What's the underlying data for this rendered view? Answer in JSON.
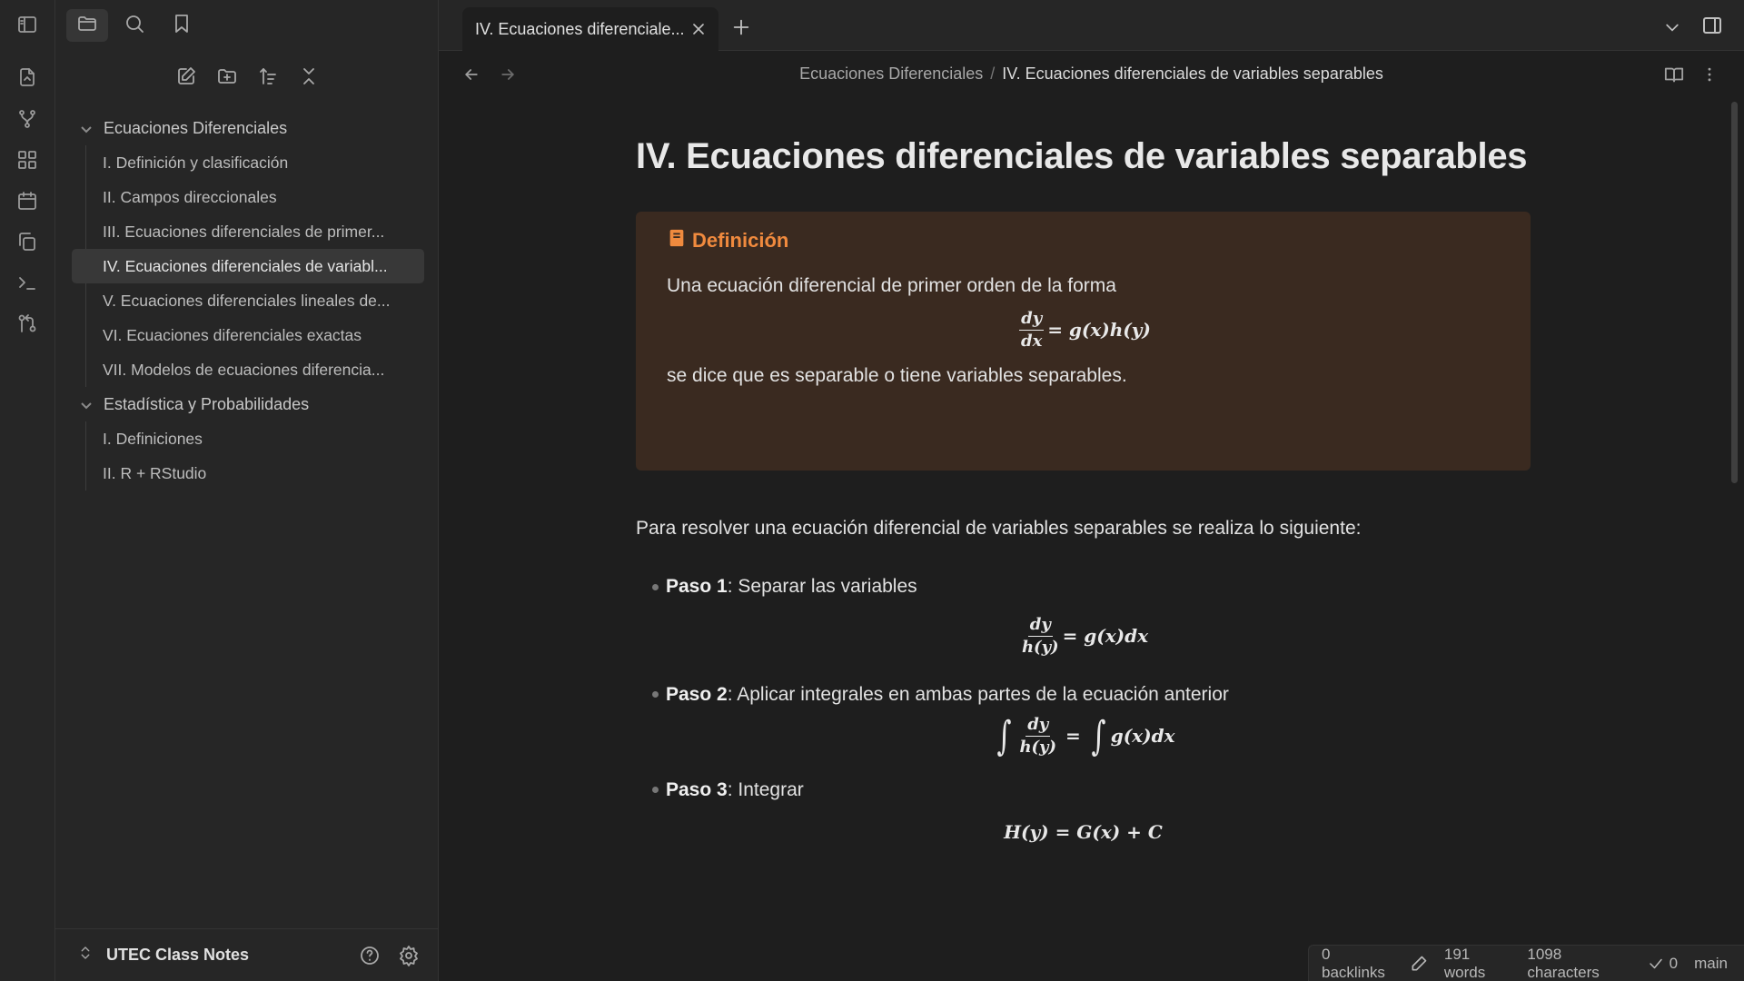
{
  "sidebar_tabs": [
    "folder-icon",
    "search-icon",
    "bookmark-icon"
  ],
  "ribbon_icons": [
    "open-quick-switcher-icon",
    "graph-view-icon",
    "canvas-icon",
    "daily-note-icon",
    "templates-icon",
    "command-palette-icon",
    "git-icon"
  ],
  "tree": {
    "folders": [
      {
        "name": "Ecuaciones Diferenciales",
        "files": [
          "I. Definición y clasificación",
          "II. Campos direccionales",
          "III. Ecuaciones diferenciales de primer...",
          "IV. Ecuaciones diferenciales de variabl...",
          "V. Ecuaciones diferenciales lineales de...",
          "VI. Ecuaciones diferenciales exactas",
          "VII. Modelos de ecuaciones diferencia..."
        ]
      },
      {
        "name": "Estadística y Probabilidades",
        "files": [
          "I. Definiciones",
          "II. R + RStudio"
        ]
      }
    ]
  },
  "vault": {
    "name": "UTEC Class Notes"
  },
  "tab": {
    "title": "IV. Ecuaciones diferenciale..."
  },
  "breadcrumb": {
    "parent": "Ecuaciones Diferenciales",
    "separator": "/",
    "current": "IV. Ecuaciones diferenciales de variables separables"
  },
  "note": {
    "title": "IV. Ecuaciones diferenciales de variables separables",
    "callout": {
      "title": "Definición",
      "intro": "Una ecuación diferencial de primer orden de la forma",
      "eq_num": "dy",
      "eq_den": "dx",
      "eq_rhs": "= g(x)h(y)",
      "outro": "se dice que es separable o tiene variables separables."
    },
    "paragraph": "Para resolver una ecuación diferencial de variables separables se realiza lo siguiente:",
    "steps": [
      {
        "label": "Paso 1",
        "text": ": Separar las variables",
        "eq_num": "dy",
        "eq_den": "h(y)",
        "eq_rhs": "= g(x)dx"
      },
      {
        "label": "Paso 2",
        "text": ": Aplicar integrales en ambas partes de la ecuación anterior",
        "eq_int": "∫",
        "eq_num": "dy",
        "eq_den": "h(y)",
        "eq_eq": "=",
        "eq_rhs": "g(x)dx"
      },
      {
        "label": "Paso 3",
        "text": ": Integrar",
        "eq": "H(y) = G(x) + C"
      }
    ]
  },
  "status": {
    "backlinks": "0 backlinks",
    "words": "191 words",
    "characters": "1098 characters",
    "sync_count": "0",
    "branch": "main"
  },
  "colors": {
    "accent": "#f08a3e",
    "callout_bg": "#3a2a20",
    "bg": "#1e1e1e",
    "panel": "#262626"
  }
}
